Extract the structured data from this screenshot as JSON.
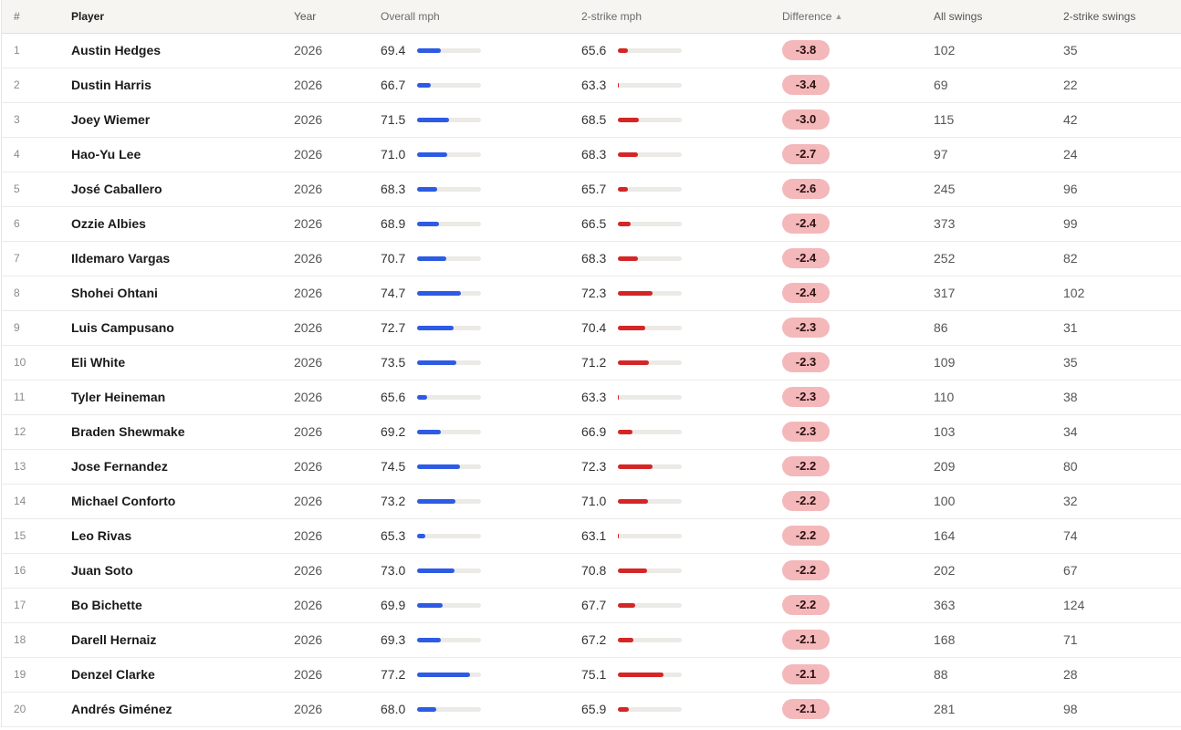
{
  "columns": {
    "rank": "#",
    "player": "Player",
    "year": "Year",
    "overall": "Overall mph",
    "two_strike": "2-strike mph",
    "difference": "Difference",
    "sort_glyph": "▲",
    "all_swings": "All swings",
    "two_strike_swings": "2-strike swings"
  },
  "colors": {
    "overall_bar": "#2d5be3",
    "two_strike_bar": "#d42626",
    "diff_badge": "#f4b8ba"
  },
  "bar_scale_mph": [
    63,
    80
  ],
  "rows": [
    {
      "rank": "1",
      "player": "Austin Hedges",
      "year": "2026",
      "overall": "69.4",
      "two_strike": "65.6",
      "diff": "-3.8",
      "all": "102",
      "two": "35"
    },
    {
      "rank": "2",
      "player": "Dustin Harris",
      "year": "2026",
      "overall": "66.7",
      "two_strike": "63.3",
      "diff": "-3.4",
      "all": "69",
      "two": "22"
    },
    {
      "rank": "3",
      "player": "Joey Wiemer",
      "year": "2026",
      "overall": "71.5",
      "two_strike": "68.5",
      "diff": "-3.0",
      "all": "115",
      "two": "42"
    },
    {
      "rank": "4",
      "player": "Hao-Yu Lee",
      "year": "2026",
      "overall": "71.0",
      "two_strike": "68.3",
      "diff": "-2.7",
      "all": "97",
      "two": "24"
    },
    {
      "rank": "5",
      "player": "José Caballero",
      "year": "2026",
      "overall": "68.3",
      "two_strike": "65.7",
      "diff": "-2.6",
      "all": "245",
      "two": "96"
    },
    {
      "rank": "6",
      "player": "Ozzie Albies",
      "year": "2026",
      "overall": "68.9",
      "two_strike": "66.5",
      "diff": "-2.4",
      "all": "373",
      "two": "99"
    },
    {
      "rank": "7",
      "player": "Ildemaro Vargas",
      "year": "2026",
      "overall": "70.7",
      "two_strike": "68.3",
      "diff": "-2.4",
      "all": "252",
      "two": "82"
    },
    {
      "rank": "8",
      "player": "Shohei Ohtani",
      "year": "2026",
      "overall": "74.7",
      "two_strike": "72.3",
      "diff": "-2.4",
      "all": "317",
      "two": "102"
    },
    {
      "rank": "9",
      "player": "Luis Campusano",
      "year": "2026",
      "overall": "72.7",
      "two_strike": "70.4",
      "diff": "-2.3",
      "all": "86",
      "two": "31"
    },
    {
      "rank": "10",
      "player": "Eli White",
      "year": "2026",
      "overall": "73.5",
      "two_strike": "71.2",
      "diff": "-2.3",
      "all": "109",
      "two": "35"
    },
    {
      "rank": "11",
      "player": "Tyler Heineman",
      "year": "2026",
      "overall": "65.6",
      "two_strike": "63.3",
      "diff": "-2.3",
      "all": "110",
      "two": "38"
    },
    {
      "rank": "12",
      "player": "Braden Shewmake",
      "year": "2026",
      "overall": "69.2",
      "two_strike": "66.9",
      "diff": "-2.3",
      "all": "103",
      "two": "34"
    },
    {
      "rank": "13",
      "player": "Jose Fernandez",
      "year": "2026",
      "overall": "74.5",
      "two_strike": "72.3",
      "diff": "-2.2",
      "all": "209",
      "two": "80"
    },
    {
      "rank": "14",
      "player": "Michael Conforto",
      "year": "2026",
      "overall": "73.2",
      "two_strike": "71.0",
      "diff": "-2.2",
      "all": "100",
      "two": "32"
    },
    {
      "rank": "15",
      "player": "Leo Rivas",
      "year": "2026",
      "overall": "65.3",
      "two_strike": "63.1",
      "diff": "-2.2",
      "all": "164",
      "two": "74"
    },
    {
      "rank": "16",
      "player": "Juan Soto",
      "year": "2026",
      "overall": "73.0",
      "two_strike": "70.8",
      "diff": "-2.2",
      "all": "202",
      "two": "67"
    },
    {
      "rank": "17",
      "player": "Bo Bichette",
      "year": "2026",
      "overall": "69.9",
      "two_strike": "67.7",
      "diff": "-2.2",
      "all": "363",
      "two": "124"
    },
    {
      "rank": "18",
      "player": "Darell Hernaiz",
      "year": "2026",
      "overall": "69.3",
      "two_strike": "67.2",
      "diff": "-2.1",
      "all": "168",
      "two": "71"
    },
    {
      "rank": "19",
      "player": "Denzel Clarke",
      "year": "2026",
      "overall": "77.2",
      "two_strike": "75.1",
      "diff": "-2.1",
      "all": "88",
      "two": "28"
    },
    {
      "rank": "20",
      "player": "Andrés Giménez",
      "year": "2026",
      "overall": "68.0",
      "two_strike": "65.9",
      "diff": "-2.1",
      "all": "281",
      "two": "98"
    }
  ]
}
